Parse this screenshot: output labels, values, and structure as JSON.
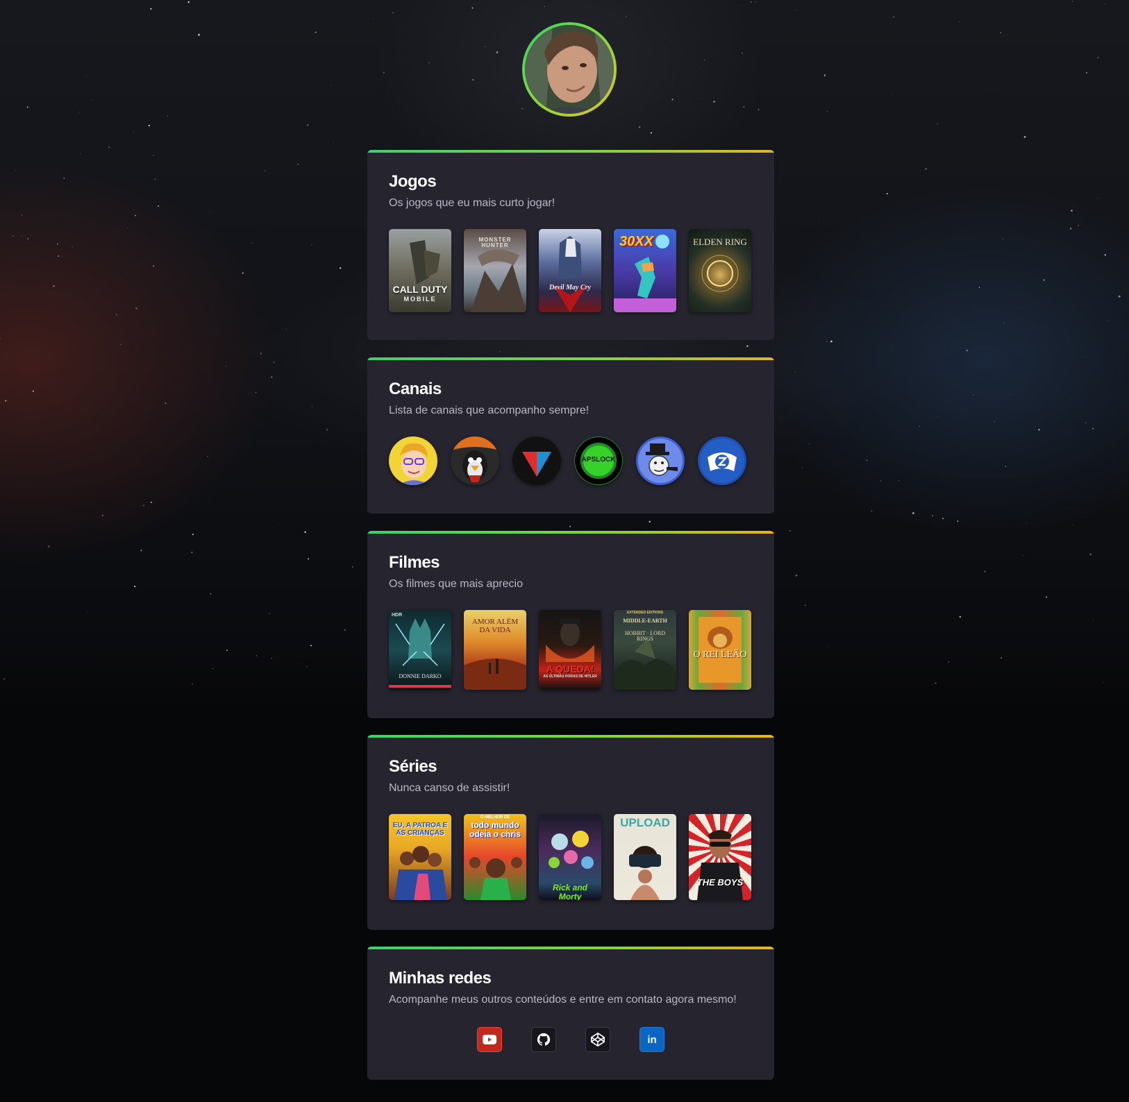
{
  "profile": {
    "avatar": "profile-photo"
  },
  "jogos": {
    "title": "Jogos",
    "subtitle": "Os jogos que eu mais curto jogar!",
    "items": [
      {
        "label": "CALL DUTY",
        "sub": "MOBILE"
      },
      {
        "label": "MONSTER HUNTER"
      },
      {
        "label": "Devil May Cry"
      },
      {
        "label": "30XX"
      },
      {
        "label": "ELDEN RING"
      }
    ]
  },
  "canais": {
    "title": "Canais",
    "subtitle": "Lista de canais que acompanho sempre!",
    "items": [
      {
        "icon": "cartoon-boy-avatar"
      },
      {
        "icon": "penguin-avatar"
      },
      {
        "icon": "red-blue-triangle-logo"
      },
      {
        "label": "APSLOCK"
      },
      {
        "icon": "top-hat-meme-avatar"
      },
      {
        "icon": "controller-logo"
      }
    ]
  },
  "filmes": {
    "title": "Filmes",
    "subtitle": "Os filmes que mais aprecio",
    "items": [
      {
        "label": "DONNIE DARKO",
        "badge": "HDR"
      },
      {
        "label": "AMOR ALÉM DA VIDA"
      },
      {
        "label": "A QUEDA!",
        "sub": "AS ÚLTIMAS HORAS DE HITLER"
      },
      {
        "label": "MIDDLE-EARTH",
        "sub": "HOBBIT · LORD RINGS",
        "badge": "EXTENDED EDITIONS"
      },
      {
        "label": "O REI LEÃO"
      }
    ]
  },
  "series": {
    "title": "Séries",
    "subtitle": "Nunca canso de assistir!",
    "items": [
      {
        "label": "EU, A PATROA E AS CRIANÇAS"
      },
      {
        "label": "todo mundo odeia o chris",
        "badge": "O MELHOR DE"
      },
      {
        "label": "Rick and Morty"
      },
      {
        "label": "UPLOAD"
      },
      {
        "label": "THE BOYS"
      }
    ]
  },
  "redes": {
    "title": "Minhas redes",
    "subtitle": "Acompanhe meus outros conteúdos e entre em contato agora mesmo!",
    "items": [
      {
        "icon": "youtube-icon"
      },
      {
        "icon": "github-icon"
      },
      {
        "icon": "codepen-icon"
      },
      {
        "label": "in",
        "icon": "linkedin-icon"
      }
    ]
  },
  "colors": {
    "card_bg": "#26252f",
    "accent_start": "#3ad36c",
    "accent_end": "#e6b41c",
    "subtitle": "#b9b8c4"
  }
}
